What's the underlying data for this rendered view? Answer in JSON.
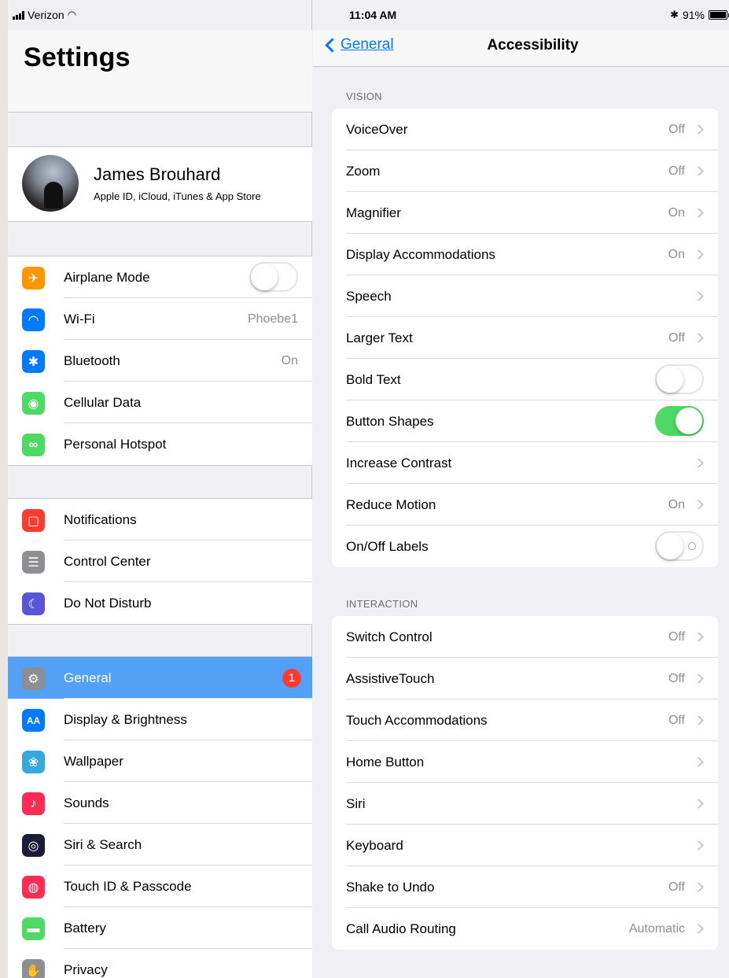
{
  "status_bar": {
    "carrier": "Verizon",
    "time": "11:04 AM",
    "battery": "91%"
  },
  "master": {
    "title": "Settings",
    "profile": {
      "name": "James Brouhard",
      "subtitle": "Apple ID, iCloud, iTunes & App Store"
    },
    "groups": [
      [
        {
          "label": "Airplane Mode",
          "icon": "airplane-icon",
          "color": "#ff9500",
          "toggle": "off"
        },
        {
          "label": "Wi-Fi",
          "icon": "wifi-icon",
          "color": "#007aff",
          "value": "Phoebe1"
        },
        {
          "label": "Bluetooth",
          "icon": "bluetooth-icon",
          "color": "#007aff",
          "value": "On"
        },
        {
          "label": "Cellular Data",
          "icon": "antenna-icon",
          "color": "#4cd964"
        },
        {
          "label": "Personal Hotspot",
          "icon": "hotspot-icon",
          "color": "#4cd964"
        }
      ],
      [
        {
          "label": "Notifications",
          "icon": "notifications-icon",
          "color": "#ff3b30"
        },
        {
          "label": "Control Center",
          "icon": "control-center-icon",
          "color": "#8e8e93"
        },
        {
          "label": "Do Not Disturb",
          "icon": "moon-icon",
          "color": "#5856d6"
        }
      ],
      [
        {
          "label": "General",
          "icon": "gear-icon",
          "color": "#8e8e93",
          "badge": "1",
          "selected": true
        },
        {
          "label": "Display & Brightness",
          "icon": "text-size-icon",
          "color": "#007aff"
        },
        {
          "label": "Wallpaper",
          "icon": "flower-icon",
          "color": "#34aadc"
        },
        {
          "label": "Sounds",
          "icon": "speaker-icon",
          "color": "#ff2d55"
        },
        {
          "label": "Siri & Search",
          "icon": "siri-icon",
          "color": "#1c1c3a"
        },
        {
          "label": "Touch ID & Passcode",
          "icon": "fingerprint-icon",
          "color": "#ff2d55"
        },
        {
          "label": "Battery",
          "icon": "battery-icon",
          "color": "#4cd964"
        },
        {
          "label": "Privacy",
          "icon": "hand-icon",
          "color": "#8e8e93"
        }
      ]
    ]
  },
  "detail": {
    "back_label": "General",
    "title": "Accessibility",
    "sections": [
      {
        "header": "VISION",
        "rows": [
          {
            "label": "VoiceOver",
            "value": "Off",
            "chevron": true
          },
          {
            "label": "Zoom",
            "value": "Off",
            "chevron": true
          },
          {
            "label": "Magnifier",
            "value": "On",
            "chevron": true
          },
          {
            "label": "Display Accommodations",
            "value": "On",
            "chevron": true
          },
          {
            "label": "Speech",
            "chevron": true
          },
          {
            "label": "Larger Text",
            "value": "Off",
            "chevron": true
          },
          {
            "label": "Bold Text",
            "toggle": "off"
          },
          {
            "label": "Button Shapes",
            "toggle": "on"
          },
          {
            "label": "Increase Contrast",
            "chevron": true
          },
          {
            "label": "Reduce Motion",
            "value": "On",
            "chevron": true
          },
          {
            "label": "On/Off Labels",
            "toggle": "off-labeled"
          }
        ]
      },
      {
        "header": "INTERACTION",
        "rows": [
          {
            "label": "Switch Control",
            "value": "Off",
            "chevron": true
          },
          {
            "label": "AssistiveTouch",
            "value": "Off",
            "chevron": true
          },
          {
            "label": "Touch Accommodations",
            "value": "Off",
            "chevron": true
          },
          {
            "label": "Home Button",
            "chevron": true
          },
          {
            "label": "Siri",
            "chevron": true
          },
          {
            "label": "Keyboard",
            "chevron": true
          },
          {
            "label": "Shake to Undo",
            "value": "Off",
            "chevron": true
          },
          {
            "label": "Call Audio Routing",
            "value": "Automatic",
            "chevron": true
          }
        ]
      }
    ]
  }
}
